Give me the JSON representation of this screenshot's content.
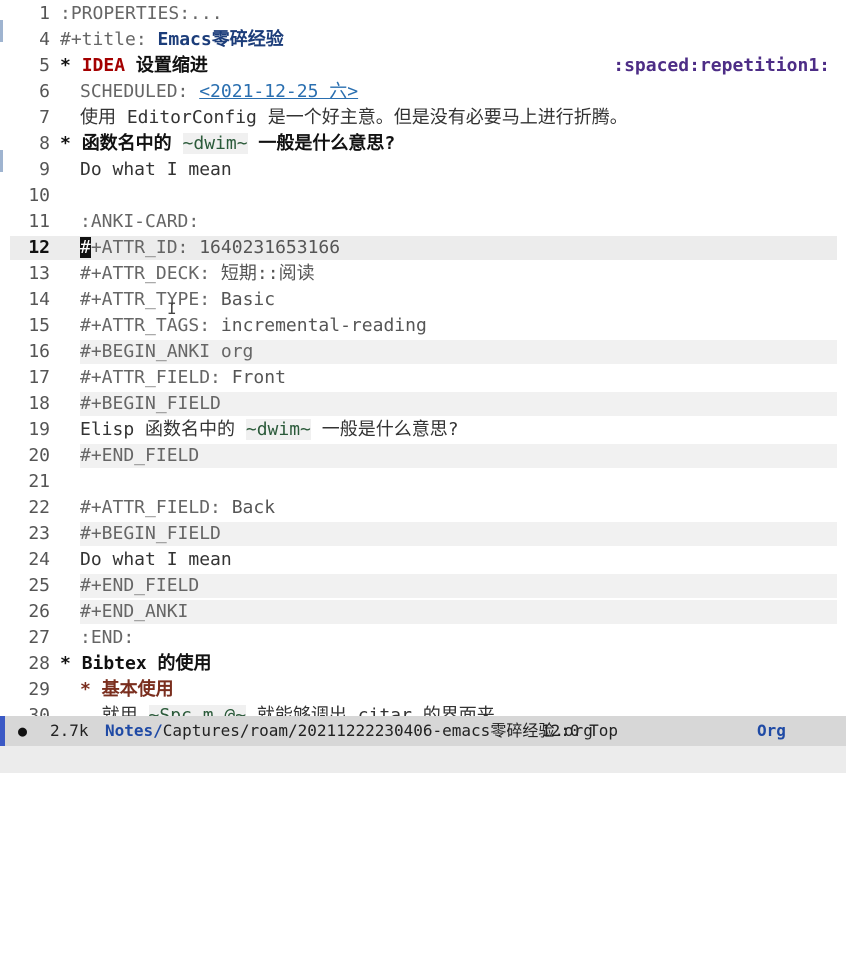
{
  "lines": [
    {
      "num": "1",
      "parts": [
        {
          "t": ":PROPERTIES:...",
          "c": "meta"
        }
      ]
    },
    {
      "num": "4",
      "parts": [
        {
          "t": "#+title: ",
          "c": "meta"
        },
        {
          "t": "Emacs零碎经验",
          "c": "title"
        }
      ]
    },
    {
      "num": "5",
      "parts": [
        {
          "t": "* ",
          "c": "star"
        },
        {
          "t": "IDEA",
          "c": "kw"
        },
        {
          "t": " 设置缩进",
          "c": "h1"
        }
      ],
      "tag": ":spaced:repetition1:"
    },
    {
      "num": "6",
      "indent": true,
      "parts": [
        {
          "t": "SCHEDULED: ",
          "c": "meta"
        },
        {
          "t": "<2021-12-25 六>",
          "c": "date"
        }
      ]
    },
    {
      "num": "7",
      "indent": true,
      "parts": [
        {
          "t": "使用 EditorConfig 是一个好主意。但是没有必要马上进行折腾。",
          "c": ""
        }
      ]
    },
    {
      "num": "8",
      "parts": [
        {
          "t": "* ",
          "c": "star"
        },
        {
          "t": "函数名中的 ",
          "c": "h1"
        },
        {
          "t": "~dwim~",
          "c": "verb"
        },
        {
          "t": " 一般是什么意思?",
          "c": "h1"
        }
      ]
    },
    {
      "num": "9",
      "indent": true,
      "parts": [
        {
          "t": "Do what I mean",
          "c": ""
        }
      ]
    },
    {
      "num": "10",
      "parts": []
    },
    {
      "num": "11",
      "indent": true,
      "parts": [
        {
          "t": ":ANKI-CARD:",
          "c": "meta"
        }
      ]
    },
    {
      "num": "12",
      "indent": true,
      "current": true,
      "parts": [
        {
          "t": "#",
          "c": "caret"
        },
        {
          "t": "+ATTR_ID: ",
          "c": "meta"
        },
        {
          "t": "1640231653166",
          "c": "metaval"
        }
      ]
    },
    {
      "num": "13",
      "indent": true,
      "parts": [
        {
          "t": "#+ATTR_DECK: ",
          "c": "meta"
        },
        {
          "t": "短期::阅读",
          "c": "metaval"
        }
      ]
    },
    {
      "num": "14",
      "indent": true,
      "parts": [
        {
          "t": "#+ATTR_TYPE: ",
          "c": "meta"
        },
        {
          "t": "Basic",
          "c": "metaval"
        }
      ]
    },
    {
      "num": "15",
      "indent": true,
      "parts": [
        {
          "t": "#+ATTR_TAGS: ",
          "c": "meta"
        },
        {
          "t": "incremental-reading",
          "c": "metaval"
        }
      ]
    },
    {
      "num": "16",
      "indent": true,
      "block": true,
      "parts": [
        {
          "t": "#+BEGIN_ANKI org",
          "c": "meta"
        }
      ]
    },
    {
      "num": "17",
      "indent": true,
      "parts": [
        {
          "t": "#+ATTR_FIELD: ",
          "c": "meta"
        },
        {
          "t": "Front",
          "c": "metaval"
        }
      ]
    },
    {
      "num": "18",
      "indent": true,
      "block": true,
      "parts": [
        {
          "t": "#+BEGIN_FIELD",
          "c": "meta"
        }
      ]
    },
    {
      "num": "19",
      "indent": true,
      "parts": [
        {
          "t": "Elisp 函数名中的 ",
          "c": ""
        },
        {
          "t": "~dwim~",
          "c": "verb"
        },
        {
          "t": " 一般是什么意思?",
          "c": ""
        }
      ]
    },
    {
      "num": "20",
      "indent": true,
      "block": true,
      "parts": [
        {
          "t": "#+END_FIELD",
          "c": "meta"
        }
      ]
    },
    {
      "num": "21",
      "parts": []
    },
    {
      "num": "22",
      "indent": true,
      "parts": [
        {
          "t": "#+ATTR_FIELD: ",
          "c": "meta"
        },
        {
          "t": "Back",
          "c": "metaval"
        }
      ]
    },
    {
      "num": "23",
      "indent": true,
      "block": true,
      "parts": [
        {
          "t": "#+BEGIN_FIELD",
          "c": "meta"
        }
      ]
    },
    {
      "num": "24",
      "indent": true,
      "parts": [
        {
          "t": "Do what I mean",
          "c": ""
        }
      ]
    },
    {
      "num": "25",
      "indent": true,
      "block": true,
      "parts": [
        {
          "t": "#+END_FIELD",
          "c": "meta"
        }
      ]
    },
    {
      "num": "26",
      "indent": true,
      "block": true,
      "parts": [
        {
          "t": "#+END_ANKI",
          "c": "meta"
        }
      ]
    },
    {
      "num": "27",
      "indent": true,
      "parts": [
        {
          "t": ":END:",
          "c": "meta"
        }
      ]
    },
    {
      "num": "28",
      "parts": [
        {
          "t": "* ",
          "c": "star"
        },
        {
          "t": "Bibtex 的使用",
          "c": "h1"
        }
      ]
    },
    {
      "num": "29",
      "indent": true,
      "parts": [
        {
          "t": "* 基本使用",
          "c": "h2"
        }
      ]
    },
    {
      "num": "30",
      "indent": true,
      "parts": [
        {
          "t": "  就用 ",
          "c": ""
        },
        {
          "t": "~Spc m @~",
          "c": "verb"
        },
        {
          "t": " 就能够调出 citar 的界面来",
          "c": ""
        }
      ]
    }
  ],
  "modeline": {
    "indicator": "●",
    "size": "2.7k",
    "path_dir": "Notes/",
    "path_file": "Captures/roam/20211222230406-emacs零碎经验.org",
    "position": "12:0 Top",
    "debug_icon": "bug-icon",
    "major_mode": "Org",
    "book_icon": "book-icon"
  },
  "colors": {
    "modeline_bg": "#d7d7d7",
    "modeline_accent": "#3b59c5",
    "todo_keyword": "#a40000",
    "tag": "#4d2d86",
    "date_link": "#2a6fb0"
  }
}
